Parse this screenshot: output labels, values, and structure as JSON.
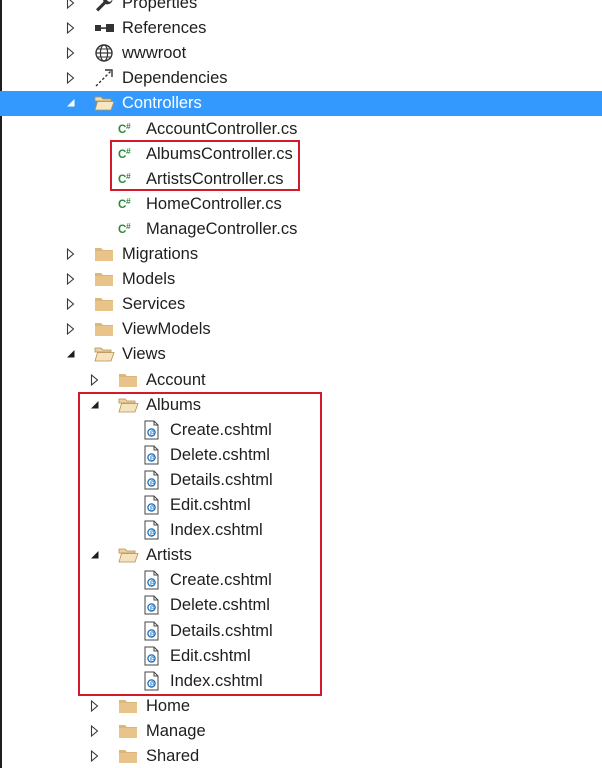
{
  "accent": {
    "selection_bg": "#3399ff",
    "highlight_border": "#d11a2a",
    "folder_color": "#dcb67a",
    "csharp_color": "#2e8b3a",
    "cshtml_color": "#1e6fb8"
  },
  "tree": [
    {
      "label": "Properties",
      "indent": 0,
      "expander": "collapsed",
      "icon": "wrench-icon",
      "selected": false
    },
    {
      "label": "References",
      "indent": 0,
      "expander": "collapsed",
      "icon": "references-icon",
      "selected": false
    },
    {
      "label": "wwwroot",
      "indent": 0,
      "expander": "collapsed",
      "icon": "globe-icon",
      "selected": false
    },
    {
      "label": "Dependencies",
      "indent": 0,
      "expander": "collapsed",
      "icon": "dependencies-icon",
      "selected": false
    },
    {
      "label": "Controllers",
      "indent": 0,
      "expander": "expanded",
      "icon": "folder-open-icon",
      "selected": true
    },
    {
      "label": "AccountController.cs",
      "indent": 1,
      "expander": "none",
      "icon": "csharp-file-icon",
      "selected": false
    },
    {
      "label": "AlbumsController.cs",
      "indent": 1,
      "expander": "none",
      "icon": "csharp-file-icon",
      "selected": false
    },
    {
      "label": "ArtistsController.cs",
      "indent": 1,
      "expander": "none",
      "icon": "csharp-file-icon",
      "selected": false
    },
    {
      "label": "HomeController.cs",
      "indent": 1,
      "expander": "none",
      "icon": "csharp-file-icon",
      "selected": false
    },
    {
      "label": "ManageController.cs",
      "indent": 1,
      "expander": "none",
      "icon": "csharp-file-icon",
      "selected": false
    },
    {
      "label": "Migrations",
      "indent": 0,
      "expander": "collapsed",
      "icon": "folder-icon",
      "selected": false
    },
    {
      "label": "Models",
      "indent": 0,
      "expander": "collapsed",
      "icon": "folder-icon",
      "selected": false
    },
    {
      "label": "Services",
      "indent": 0,
      "expander": "collapsed",
      "icon": "folder-icon",
      "selected": false
    },
    {
      "label": "ViewModels",
      "indent": 0,
      "expander": "collapsed",
      "icon": "folder-icon",
      "selected": false
    },
    {
      "label": "Views",
      "indent": 0,
      "expander": "expanded",
      "icon": "folder-open-icon",
      "selected": false
    },
    {
      "label": "Account",
      "indent": 1,
      "expander": "collapsed",
      "icon": "folder-icon",
      "selected": false
    },
    {
      "label": "Albums",
      "indent": 1,
      "expander": "expanded",
      "icon": "folder-open-icon",
      "selected": false
    },
    {
      "label": "Create.cshtml",
      "indent": 2,
      "expander": "none",
      "icon": "cshtml-file-icon",
      "selected": false
    },
    {
      "label": "Delete.cshtml",
      "indent": 2,
      "expander": "none",
      "icon": "cshtml-file-icon",
      "selected": false
    },
    {
      "label": "Details.cshtml",
      "indent": 2,
      "expander": "none",
      "icon": "cshtml-file-icon",
      "selected": false
    },
    {
      "label": "Edit.cshtml",
      "indent": 2,
      "expander": "none",
      "icon": "cshtml-file-icon",
      "selected": false
    },
    {
      "label": "Index.cshtml",
      "indent": 2,
      "expander": "none",
      "icon": "cshtml-file-icon",
      "selected": false
    },
    {
      "label": "Artists",
      "indent": 1,
      "expander": "expanded",
      "icon": "folder-open-icon",
      "selected": false
    },
    {
      "label": "Create.cshtml",
      "indent": 2,
      "expander": "none",
      "icon": "cshtml-file-icon",
      "selected": false
    },
    {
      "label": "Delete.cshtml",
      "indent": 2,
      "expander": "none",
      "icon": "cshtml-file-icon",
      "selected": false
    },
    {
      "label": "Details.cshtml",
      "indent": 2,
      "expander": "none",
      "icon": "cshtml-file-icon",
      "selected": false
    },
    {
      "label": "Edit.cshtml",
      "indent": 2,
      "expander": "none",
      "icon": "cshtml-file-icon",
      "selected": false
    },
    {
      "label": "Index.cshtml",
      "indent": 2,
      "expander": "none",
      "icon": "cshtml-file-icon",
      "selected": false
    },
    {
      "label": "Home",
      "indent": 1,
      "expander": "collapsed",
      "icon": "folder-icon",
      "selected": false
    },
    {
      "label": "Manage",
      "indent": 1,
      "expander": "collapsed",
      "icon": "folder-icon",
      "selected": false
    },
    {
      "label": "Shared",
      "indent": 1,
      "expander": "collapsed",
      "icon": "folder-icon",
      "selected": false
    }
  ]
}
